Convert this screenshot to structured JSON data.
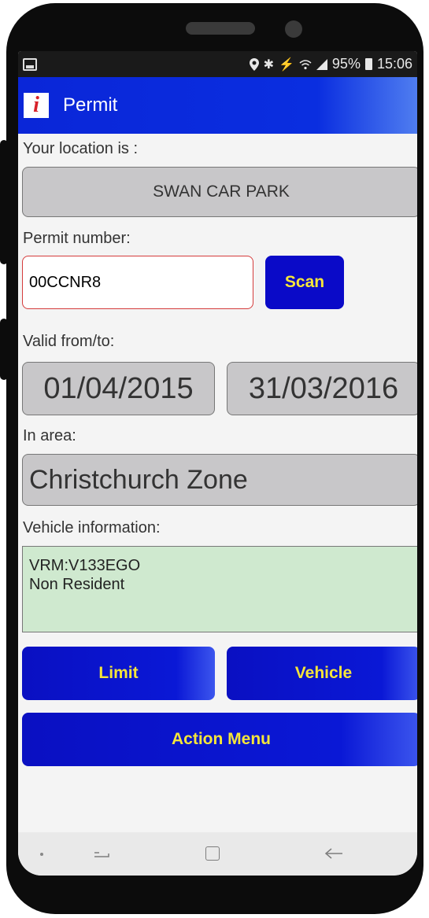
{
  "status_bar": {
    "battery": "95%",
    "time": "15:06",
    "icons": [
      "gallery-icon",
      "location-icon",
      "bluetooth-icon",
      "mute-icon",
      "wifi-icon",
      "signal-icon",
      "battery-icon"
    ]
  },
  "app_bar": {
    "logo_letter": "i",
    "title": "Permit",
    "color": "#0a26d8"
  },
  "form": {
    "location_label": "Your location is :",
    "location_value": "SWAN CAR PARK",
    "permit_label": "Permit number:",
    "permit_value": "00CCNR8",
    "scan_label": "Scan",
    "valid_label": "Valid from/to:",
    "valid_from": "01/04/2015",
    "valid_to": "31/03/2016",
    "area_label": "In area:",
    "area_value": "Christchurch Zone",
    "vehicle_label": "Vehicle information:",
    "vehicle_lines": [
      "VRM:V133EGO",
      "Non Resident"
    ]
  },
  "buttons": {
    "limit": "Limit",
    "vehicle": "Vehicle",
    "action_menu": "Action Menu"
  },
  "colors": {
    "button_blue": "#0a0ac8",
    "button_text": "#f5e63a",
    "vehicle_bg": "#cfe9cf",
    "input_border": "#d43b3b"
  }
}
